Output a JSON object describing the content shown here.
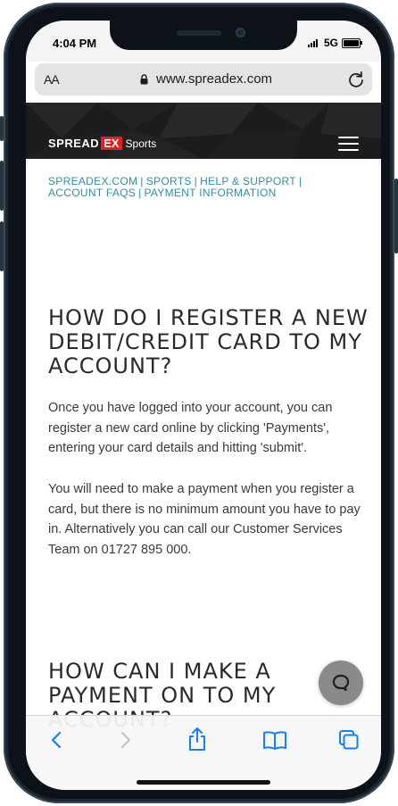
{
  "status_bar": {
    "time": "4:04 PM",
    "network": "5G"
  },
  "browser": {
    "text_size_label": "AA",
    "url": "www.spreadex.com"
  },
  "site_header": {
    "logo_main": "SPREAD",
    "logo_ex": "EX",
    "logo_sub": "Sports"
  },
  "breadcrumb": {
    "items": [
      "SPREADEX.COM",
      "SPORTS",
      "HELP & SUPPORT",
      "ACCOUNT FAQS",
      "PAYMENT INFORMATION"
    ],
    "separator": "|"
  },
  "article": {
    "heading1": "HOW DO I REGISTER A NEW DEBIT/CREDIT CARD TO MY ACCOUNT?",
    "para1": "Once you have logged into your account, you can register a new card online by clicking 'Payments', entering your card details and hitting 'submit'.",
    "para2": "You will need to make a payment when you register a card, but there is no minimum amount you have to pay in. Alternatively you can call our Customer Services Team on 01727 895 000.",
    "heading2": "HOW CAN I MAKE A PAYMENT ON TO MY ACCOUNT?"
  },
  "colors": {
    "link": "#2f8fa0",
    "brand_red": "#e31e24",
    "ios_blue": "#147efb",
    "header_bg": "#1c1c1c"
  },
  "icons": {
    "toolbar": [
      "back-arrow-icon",
      "forward-arrow-icon",
      "share-icon",
      "bookmarks-icon",
      "tabs-icon"
    ],
    "chat": "chat-bubble-icon"
  }
}
